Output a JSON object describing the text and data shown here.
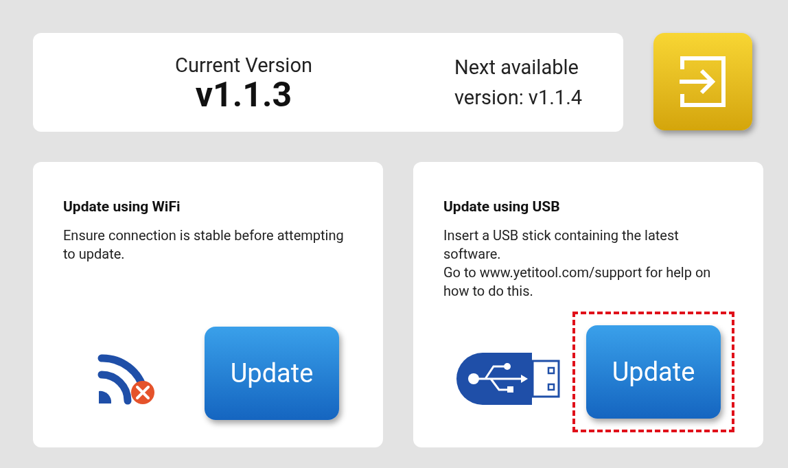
{
  "version_panel": {
    "current_label": "Current Version",
    "current_value": "v1.1.3",
    "next_text": "Next available version: v1.1.4"
  },
  "cards": [
    {
      "kind": "wifi",
      "title": "Update using WiFi",
      "description": [
        "Ensure connection is stable before attempting to update."
      ],
      "button": "Update",
      "highlighted": false
    },
    {
      "kind": "usb",
      "title": "Update using USB",
      "description": [
        "Insert a USB stick containing the latest software.",
        "Go to www.yetitool.com/support for help on how to do this."
      ],
      "button": "Update",
      "highlighted": true
    }
  ]
}
